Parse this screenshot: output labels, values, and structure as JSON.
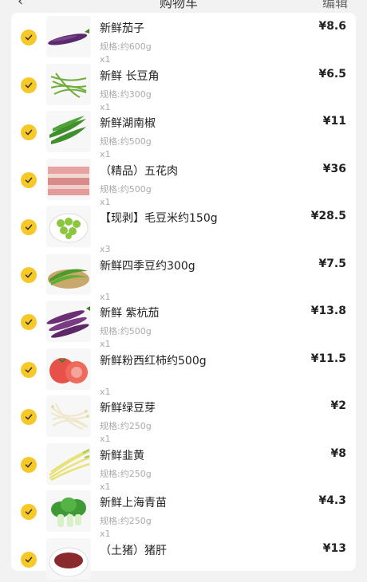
{
  "header": {
    "back_icon": "‹",
    "title": "购物车",
    "right_label": "编辑"
  },
  "check_color": "#f7c928",
  "items": [
    {
      "name": "新鲜茄子",
      "spec": "规格:约600g",
      "qty": "x1",
      "price": "¥8.6",
      "thumb": "eggplant"
    },
    {
      "name": "新鲜 长豆角",
      "spec": "规格:约300g",
      "qty": "x1",
      "price": "¥6.5",
      "thumb": "long-bean"
    },
    {
      "name": "新鲜湖南椒",
      "spec": "规格:约500g",
      "qty": "x1",
      "price": "¥11",
      "thumb": "green-pepper"
    },
    {
      "name": "（精品）五花肉",
      "spec": "规格:约500g",
      "qty": "x1",
      "price": "¥36",
      "thumb": "pork-belly"
    },
    {
      "name": "【现剥】毛豆米约150g",
      "spec": "",
      "qty": "x3",
      "price": "¥28.5",
      "thumb": "edamame"
    },
    {
      "name": "新鲜四季豆约300g",
      "spec": "",
      "qty": "x1",
      "price": "¥7.5",
      "thumb": "green-bean"
    },
    {
      "name": "新鲜 紫杭茄",
      "spec": "规格:约500g",
      "qty": "x1",
      "price": "¥13.8",
      "thumb": "purple-eggplant"
    },
    {
      "name": "新鲜粉西红柿约500g",
      "spec": "",
      "qty": "x1",
      "price": "¥11.5",
      "thumb": "tomato"
    },
    {
      "name": "新鲜绿豆芽",
      "spec": "规格:约250g",
      "qty": "x1",
      "price": "¥2",
      "thumb": "bean-sprout"
    },
    {
      "name": "新鲜韭黄",
      "spec": "规格:约250g",
      "qty": "x1",
      "price": "¥8",
      "thumb": "chive"
    },
    {
      "name": "新鲜上海青苗",
      "spec": "规格:约250g",
      "qty": "x1",
      "price": "¥4.3",
      "thumb": "bok-choy"
    },
    {
      "name": "（土猪）猪肝",
      "spec": "",
      "qty": "",
      "price": "¥13",
      "thumb": "pork-liver"
    }
  ]
}
